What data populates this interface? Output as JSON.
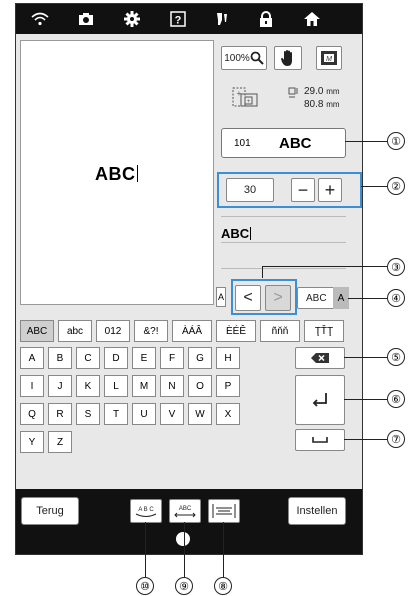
{
  "status_icons": [
    "wifi-icon",
    "camera-icon",
    "settings-icon",
    "help-icon",
    "needle-icon",
    "lock-icon",
    "home-icon"
  ],
  "toolbar": {
    "zoom_label": "100%"
  },
  "size_display": {
    "width": "29.0",
    "height": "80.8",
    "unit": "mm"
  },
  "preview": {
    "text": "ABC"
  },
  "pattern": {
    "number": "101",
    "name": "ABC"
  },
  "size_adjust": {
    "value": "30",
    "minus": "−",
    "plus": "+"
  },
  "edit_line": {
    "text": "ABC"
  },
  "font_row": {
    "small_a": "A",
    "left_arrow": "<",
    "right_arrow": ">",
    "font_label": "ABC",
    "font_a": "A"
  },
  "char_tabs": [
    "ABC",
    "abc",
    "012",
    "&?!",
    "ÀÁÂ",
    "ÈÉÊ",
    "ñňň",
    "ŢŤŢ"
  ],
  "keys": {
    "row1": [
      "A",
      "B",
      "C",
      "D",
      "E",
      "F",
      "G",
      "H"
    ],
    "row2": [
      "I",
      "J",
      "K",
      "L",
      "M",
      "N",
      "O",
      "P"
    ],
    "row3": [
      "Q",
      "R",
      "S",
      "T",
      "U",
      "V",
      "W",
      "X"
    ],
    "row4": [
      "Y",
      "Z"
    ]
  },
  "bottom": {
    "back_label": "Terug",
    "set_label": "Instellen",
    "tool1_label": "A B C",
    "tool2_label": "ABC",
    "tool3_label": ""
  },
  "callouts": [
    "①",
    "②",
    "③",
    "④",
    "⑤",
    "⑥",
    "⑦",
    "⑧",
    "⑨",
    "⑩"
  ],
  "colors": {
    "bar": "#111111",
    "screen": "#e8e8e8",
    "highlight": "#3a8fd6"
  }
}
